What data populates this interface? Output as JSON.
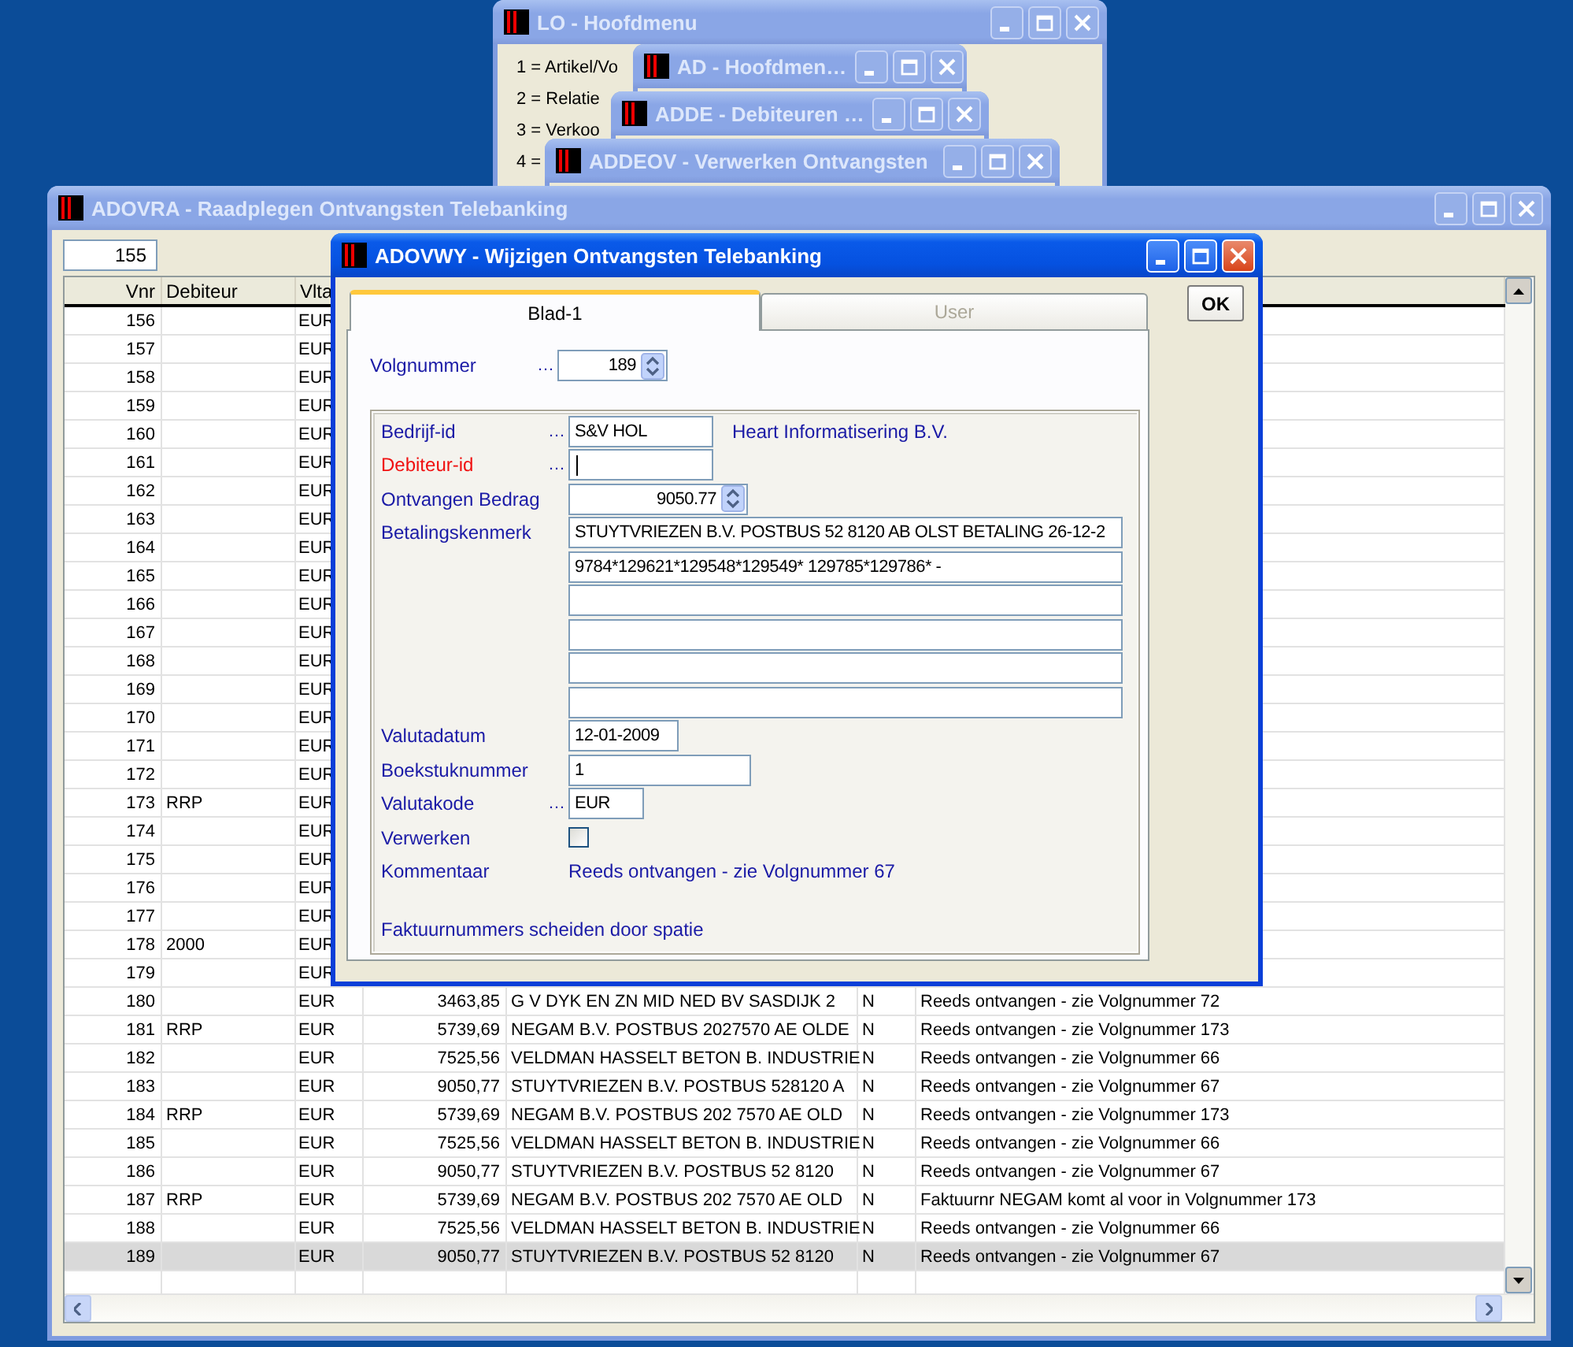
{
  "windows": [
    {
      "title": "LO - Hoofdmenu",
      "active": false,
      "menu_items": [
        "1 = Artikel/Vo",
        "2 = Relatie",
        "3 = Verkoo",
        "4 ="
      ]
    },
    {
      "title": "AD - Hoofdmen…",
      "active": false
    },
    {
      "title": "ADDE - Debiteuren …",
      "active": false
    },
    {
      "title": "ADDEOV - Verwerken Ontvangsten",
      "active": false
    }
  ],
  "list_window": {
    "title": "ADOVRA - Raadplegen Ontvangsten Telebanking",
    "active": false,
    "start_number": "155",
    "columns": [
      "Vnr",
      "Debiteur",
      "Vlta"
    ],
    "rows": [
      {
        "vnr": "156",
        "currency": "EUR",
        "selected": false
      },
      {
        "vnr": "157",
        "currency": "EUR",
        "selected": false
      },
      {
        "vnr": "158",
        "currency": "EUR",
        "selected": false
      },
      {
        "vnr": "159",
        "currency": "EUR",
        "selected": false
      },
      {
        "vnr": "160",
        "currency": "EUR",
        "selected": false
      },
      {
        "vnr": "161",
        "currency": "EUR",
        "selected": false
      },
      {
        "vnr": "162",
        "currency": "EUR",
        "selected": false
      },
      {
        "vnr": "163",
        "currency": "EUR",
        "selected": false
      },
      {
        "vnr": "164",
        "currency": "EUR",
        "selected": false
      },
      {
        "vnr": "165",
        "currency": "EUR",
        "selected": false
      },
      {
        "vnr": "166",
        "currency": "EUR",
        "selected": false
      },
      {
        "vnr": "167",
        "currency": "EUR",
        "selected": false
      },
      {
        "vnr": "168",
        "currency": "EUR",
        "selected": false
      },
      {
        "vnr": "169",
        "currency": "EUR",
        "selected": false
      },
      {
        "vnr": "170",
        "currency": "EUR",
        "selected": false
      },
      {
        "vnr": "171",
        "currency": "EUR",
        "selected": false
      },
      {
        "vnr": "172",
        "currency": "EUR",
        "selected": false
      },
      {
        "vnr": "173",
        "debiteur": "RRP",
        "currency": "EUR",
        "selected": false
      },
      {
        "vnr": "174",
        "currency": "EUR",
        "selected": false
      },
      {
        "vnr": "175",
        "currency": "EUR",
        "selected": false
      },
      {
        "vnr": "176",
        "currency": "EUR",
        "selected": false
      },
      {
        "vnr": "177",
        "currency": "EUR",
        "selected": false
      },
      {
        "vnr": "178",
        "debiteur": "2000",
        "currency": "EUR",
        "selected": false
      },
      {
        "vnr": "179",
        "currency": "EUR",
        "selected": false
      },
      {
        "vnr": "180",
        "currency": "EUR",
        "amount": "3463,85",
        "description": "G V DYK EN ZN MID NED BV SASDIJK 2",
        "flag": "N",
        "comment": "Reeds ontvangen - zie Volgnummer 72",
        "selected": false
      },
      {
        "vnr": "181",
        "debiteur": "RRP",
        "currency": "EUR",
        "amount": "5739,69",
        "description": "NEGAM B.V. POSTBUS 2027570 AE OLDE",
        "flag": "N",
        "comment": "Reeds ontvangen - zie Volgnummer 173",
        "selected": false
      },
      {
        "vnr": "182",
        "currency": "EUR",
        "amount": "7525,56",
        "description": "VELDMAN HASSELT BETON B. INDUSTRIE",
        "flag": "N",
        "comment": "Reeds ontvangen - zie Volgnummer 66",
        "selected": false
      },
      {
        "vnr": "183",
        "currency": "EUR",
        "amount": "9050,77",
        "description": "STUYTVRIEZEN B.V. POSTBUS 528120 A",
        "flag": "N",
        "comment": "Reeds ontvangen - zie Volgnummer 67",
        "selected": false
      },
      {
        "vnr": "184",
        "debiteur": "RRP",
        "currency": "EUR",
        "amount": "5739,69",
        "description": "NEGAM B.V. POSTBUS 202 7570 AE OLD",
        "flag": "N",
        "comment": "Reeds ontvangen - zie Volgnummer 173",
        "selected": false
      },
      {
        "vnr": "185",
        "currency": "EUR",
        "amount": "7525,56",
        "description": "VELDMAN HASSELT BETON B. INDUSTRIE",
        "flag": "N",
        "comment": "Reeds ontvangen - zie Volgnummer 66",
        "selected": false
      },
      {
        "vnr": "186",
        "currency": "EUR",
        "amount": "9050,77",
        "description": "STUYTVRIEZEN B.V. POSTBUS 52 8120",
        "flag": "N",
        "comment": "Reeds ontvangen - zie Volgnummer 67",
        "selected": false
      },
      {
        "vnr": "187",
        "debiteur": "RRP",
        "currency": "EUR",
        "amount": "5739,69",
        "description": "NEGAM B.V. POSTBUS 202 7570 AE OLD",
        "flag": "N",
        "comment": "Faktuurnr NEGAM komt al voor in Volgnummer 173",
        "selected": false
      },
      {
        "vnr": "188",
        "currency": "EUR",
        "amount": "7525,56",
        "description": "VELDMAN HASSELT BETON B. INDUSTRIE",
        "flag": "N",
        "comment": "Reeds ontvangen - zie Volgnummer 66",
        "selected": false
      },
      {
        "vnr": "189",
        "currency": "EUR",
        "amount": "9050,77",
        "description": "STUYTVRIEZEN B.V. POSTBUS 52 8120",
        "flag": "N",
        "comment": "Reeds ontvangen - zie Volgnummer 67",
        "selected": true
      }
    ]
  },
  "dialog": {
    "title": "ADOVWY - Wijzigen Ontvangsten Telebanking",
    "active": true,
    "tabs": [
      {
        "label": "Blad-1",
        "selected": true
      },
      {
        "label": "User",
        "selected": false
      }
    ],
    "ok_button": "OK",
    "sequence": {
      "label": "Volgnummer",
      "lookup_button": "…",
      "value": "189"
    },
    "fields": [
      {
        "kind": "text",
        "label": "Bedrijf-id",
        "lookup_button": "…",
        "required": false,
        "focused": false,
        "value": "S&V HOL",
        "description": "Heart Informatisering B.V."
      },
      {
        "kind": "text",
        "label": "Debiteur-id",
        "lookup_button": "…",
        "required": true,
        "focused": true
      },
      {
        "kind": "spinner",
        "label": "Ontvangen Bedrag",
        "required": false,
        "focused": false,
        "value": "9050.77"
      },
      {
        "kind": "lines",
        "label": "Betalingskenmerk",
        "required": false,
        "lines": [
          {
            "value": "STUYTVRIEZEN B.V. POSTBUS 52 8120 AB OLST BETALING 26-12-2"
          },
          {
            "value": "9784*129621*129548*129549* 129785*129786* -"
          },
          {
            "kind": "empty"
          },
          {
            "kind": "empty"
          },
          {
            "kind": "empty"
          },
          {
            "kind": "empty"
          }
        ]
      },
      {
        "kind": "text",
        "label": "Valutadatum",
        "required": false,
        "focused": false,
        "value": "12-01-2009"
      },
      {
        "kind": "text",
        "label": "Boekstuknummer",
        "required": false,
        "focused": false,
        "value": "1"
      },
      {
        "kind": "text",
        "label": "Valutakode",
        "lookup_button": "…",
        "required": false,
        "focused": false,
        "value": "EUR"
      },
      {
        "kind": "checkbox",
        "label": "Verwerken",
        "required": false,
        "checked": false
      },
      {
        "kind": "display",
        "label": "Kommentaar",
        "required": false,
        "value": "Reeds ontvangen - zie Volgnummer 67"
      }
    ],
    "note": "Faktuurnummers scheiden door spatie"
  }
}
